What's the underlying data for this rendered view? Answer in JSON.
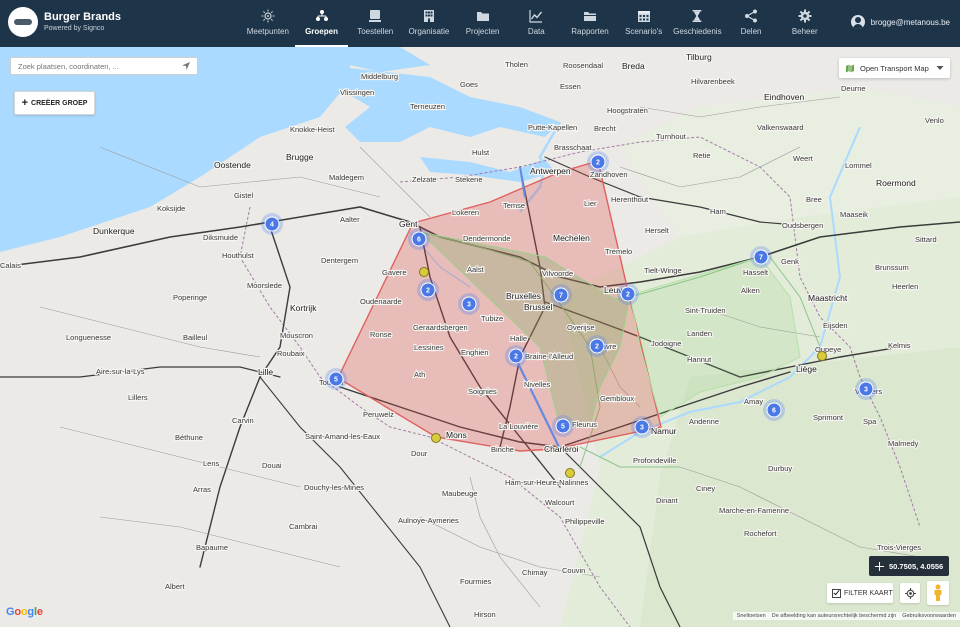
{
  "app": {
    "title": "Burger Brands",
    "subtitle": "Powered by Signco"
  },
  "nav": [
    {
      "label": "Meetpunten",
      "icon": "sensor-icon",
      "active": false
    },
    {
      "label": "Groepen",
      "icon": "groups-icon",
      "active": true
    },
    {
      "label": "Toestellen",
      "icon": "device-icon",
      "active": false
    },
    {
      "label": "Organisatie",
      "icon": "building-icon",
      "active": false
    },
    {
      "label": "Projecten",
      "icon": "folder-icon",
      "active": false
    },
    {
      "label": "Data",
      "icon": "chart-icon",
      "active": false
    },
    {
      "label": "Rapporten",
      "icon": "reports-icon",
      "active": false
    },
    {
      "label": "Scenario's",
      "icon": "calendar-icon",
      "active": false
    },
    {
      "label": "Geschiedenis",
      "icon": "hourglass-icon",
      "active": false
    },
    {
      "label": "Delen",
      "icon": "share-icon",
      "active": false
    },
    {
      "label": "Beheer",
      "icon": "gear-icon",
      "active": false
    }
  ],
  "user": {
    "email": "brogge@metanous.be"
  },
  "search": {
    "placeholder": "Zoek plaatsen, coordinaten, ..."
  },
  "create_group": {
    "label": "CREËER GROEP"
  },
  "layer_select": {
    "selected": "Open Transport Map"
  },
  "coordinates": {
    "text": "50.7505, 4.0556"
  },
  "filter": {
    "label": "FILTER KAART",
    "checked": true
  },
  "google": {
    "logo": "Google"
  },
  "attribution": {
    "shortcuts": "Sneltoetsen",
    "copyright": "De afbeelding kan auteursrechtelijk beschermd zijn",
    "terms": "Gebruiksvoorwaarden"
  },
  "clusters": [
    "2",
    "4",
    "6",
    "2",
    "3",
    "7",
    "2",
    "2",
    "2",
    "7",
    "5",
    "5",
    "3",
    "6",
    "3"
  ],
  "towns": [
    "Middelburg",
    "Tholen",
    "Roosendaal",
    "Tilburg",
    "Vlissingen",
    "Goes",
    "Essen",
    "Hilvarenbeek",
    "Deurne",
    "Terneuzen",
    "Breda",
    "Eindhoven",
    "Hoogstraten",
    "Knokke-Heist",
    "Hulst",
    "Putte-Kapellen",
    "Brecht",
    "Valkenswaard",
    "Venlo",
    "Oostende",
    "Brugge",
    "Maldegem",
    "Zelzate",
    "Stekene",
    "Brasschaat",
    "Zandhoven",
    "Turnhout",
    "Retie",
    "Weert",
    "Roermond",
    "Gistel",
    "Antwerpen",
    "Herenthout",
    "Bree",
    "Koksijde",
    "Aalter",
    "Gent",
    "Lokeren",
    "Temse",
    "Lier",
    "Ham",
    "Maaseik",
    "Dunkerque",
    "Diksmuide",
    "Dendermonde",
    "Mechelen",
    "Herselt",
    "Oudsbergen",
    "Houthulst",
    "Dentergem",
    "Tremelo",
    "Genk",
    "Sittard",
    "Aalst",
    "Vilvoorde",
    "Tielt-Winge",
    "Hasselt",
    "Brunssum",
    "Moorslede",
    "Gavere",
    "Heerlen",
    "Alken",
    "Poperinge",
    "Oudenaarde",
    "Bruxelles",
    "Brussel",
    "Leuven",
    "Maastricht",
    "Kortrijk",
    "Ronse",
    "Geraardsbergen",
    "Overijse",
    "Sint-Truiden",
    "Eijsden",
    "Bailleul",
    "Mouscron",
    "Landen",
    "Longuenesse",
    "Roubaix",
    "Lessines",
    "Enghien",
    "Halle",
    "Wavre",
    "Jodoigne",
    "Kelmis",
    "Lille",
    "Braine-l'Alleud",
    "Hannut",
    "Oupeye",
    "Aire-sur-la-Lys",
    "Tournai",
    "Ath",
    "Nivelles",
    "Liège",
    "Lillers",
    "Soignies",
    "Gembloux",
    "Amay",
    "Verviers",
    "Carvin",
    "Peruwelz",
    "La Louvière",
    "Andenne",
    "Spa",
    "Saint-Amand-les-Eaux",
    "Mons",
    "Fleurus",
    "Sprimont",
    "Malmedy",
    "Béthune",
    "Dour",
    "Binche",
    "Charleroi",
    "Namur",
    "Lens",
    "Douai",
    "Profondeville",
    "Durbuy",
    "Arras",
    "Douchy-les-Mines",
    "Ham-sur-Heure-Nalinnes",
    "Ciney",
    "Maubeuge",
    "Dinant",
    "Walcourt",
    "Marche-en-Famenne",
    "Cambrai",
    "Aulnoye-Aymeries",
    "Philippeville",
    "Rochefort",
    "Bapaume",
    "Trois-Vierges",
    "Albert",
    "Chimay",
    "Couvin",
    "Fourmies",
    "Hirson",
    "Calais",
    "Tubize",
    "Lommel"
  ]
}
